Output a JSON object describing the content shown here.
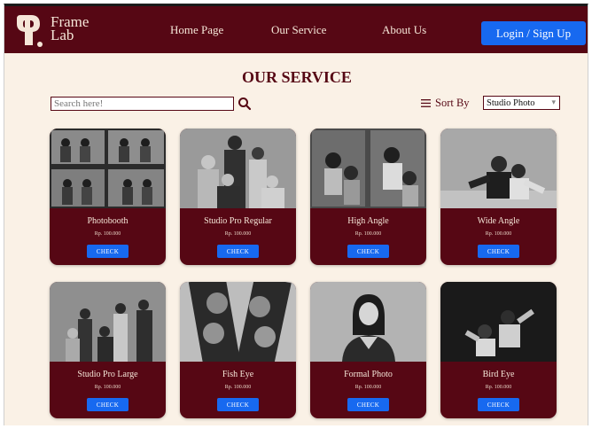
{
  "brand": {
    "name_line1": "Frame",
    "name_line2": "Lab"
  },
  "nav": [
    {
      "label": "Home Page"
    },
    {
      "label": "Our Service"
    },
    {
      "label": "About Us"
    }
  ],
  "login_label": "Login / Sign Up",
  "page_title": "OUR SERVICE",
  "search": {
    "placeholder": "Search here!",
    "value": ""
  },
  "sort": {
    "label": "Sort By",
    "selected": "Studio Photo"
  },
  "services": [
    {
      "name": "Photobooth",
      "price": "Rp. 100.000",
      "button": "CHECK",
      "photo_icon": "photobooth-strip-image"
    },
    {
      "name": "Studio Pro Regular",
      "price": "Rp. 100.000",
      "button": "CHECK",
      "photo_icon": "family-portrait-image"
    },
    {
      "name": "High Angle",
      "price": "Rp. 100.000",
      "button": "CHECK",
      "photo_icon": "high-angle-image"
    },
    {
      "name": "Wide Angle",
      "price": "Rp. 100.000",
      "button": "CHECK",
      "photo_icon": "wide-angle-image"
    },
    {
      "name": "Studio Pro Large",
      "price": "Rp. 100.000",
      "button": "CHECK",
      "photo_icon": "large-group-image"
    },
    {
      "name": "Fish Eye",
      "price": "Rp. 100.000",
      "button": "CHECK",
      "photo_icon": "fish-eye-image"
    },
    {
      "name": "Formal Photo",
      "price": "Rp. 100.000",
      "button": "CHECK",
      "photo_icon": "formal-portrait-image"
    },
    {
      "name": "Bird Eye",
      "price": "Rp. 100.000",
      "button": "CHECK",
      "photo_icon": "bird-eye-image"
    }
  ],
  "colors": {
    "primary": "#560714",
    "accent": "#1769f0",
    "background": "#faf1e6"
  }
}
